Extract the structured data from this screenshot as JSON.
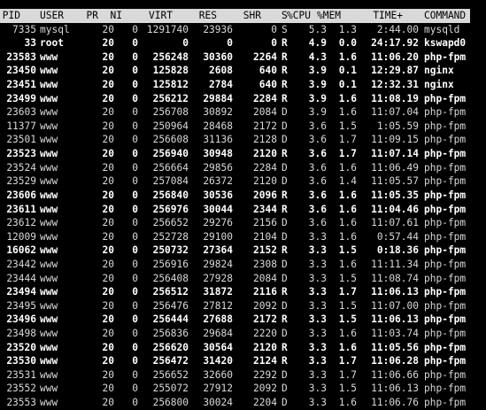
{
  "columns": {
    "pid": "PID",
    "user": "USER",
    "pr": "PR",
    "ni": "NI",
    "virt": "VIRT",
    "res": "RES",
    "shr": "SHR",
    "s": "S",
    "cpu": "%CPU",
    "mem": "%MEM",
    "time": "TIME+",
    "command": "COMMAND"
  },
  "processes": [
    {
      "pid": "7335",
      "user": "mysql",
      "pr": "20",
      "ni": "0",
      "virt": "1291740",
      "res": "23936",
      "shr": "0",
      "s": "S",
      "cpu": "5.3",
      "mem": "1.3",
      "time": "2:44.00",
      "command": "mysqld",
      "bold": false
    },
    {
      "pid": "33",
      "user": "root",
      "pr": "20",
      "ni": "0",
      "virt": "0",
      "res": "0",
      "shr": "0",
      "s": "R",
      "cpu": "4.9",
      "mem": "0.0",
      "time": "24:17.92",
      "command": "kswapd0",
      "bold": true
    },
    {
      "pid": "23583",
      "user": "www",
      "pr": "20",
      "ni": "0",
      "virt": "256248",
      "res": "30360",
      "shr": "2264",
      "s": "R",
      "cpu": "4.3",
      "mem": "1.6",
      "time": "11:06.20",
      "command": "php-fpm",
      "bold": true
    },
    {
      "pid": "23450",
      "user": "www",
      "pr": "20",
      "ni": "0",
      "virt": "125828",
      "res": "2608",
      "shr": "640",
      "s": "R",
      "cpu": "3.9",
      "mem": "0.1",
      "time": "12:29.87",
      "command": "nginx",
      "bold": true
    },
    {
      "pid": "23451",
      "user": "www",
      "pr": "20",
      "ni": "0",
      "virt": "125812",
      "res": "2784",
      "shr": "640",
      "s": "R",
      "cpu": "3.9",
      "mem": "0.1",
      "time": "12:32.31",
      "command": "nginx",
      "bold": true
    },
    {
      "pid": "23499",
      "user": "www",
      "pr": "20",
      "ni": "0",
      "virt": "256212",
      "res": "29884",
      "shr": "2284",
      "s": "R",
      "cpu": "3.9",
      "mem": "1.6",
      "time": "11:08.19",
      "command": "php-fpm",
      "bold": true
    },
    {
      "pid": "23603",
      "user": "www",
      "pr": "20",
      "ni": "0",
      "virt": "256708",
      "res": "30892",
      "shr": "2084",
      "s": "D",
      "cpu": "3.9",
      "mem": "1.6",
      "time": "11:07.04",
      "command": "php-fpm",
      "bold": false
    },
    {
      "pid": "11377",
      "user": "www",
      "pr": "20",
      "ni": "0",
      "virt": "250964",
      "res": "28468",
      "shr": "2172",
      "s": "D",
      "cpu": "3.6",
      "mem": "1.5",
      "time": "1:05.59",
      "command": "php-fpm",
      "bold": false
    },
    {
      "pid": "23501",
      "user": "www",
      "pr": "20",
      "ni": "0",
      "virt": "256608",
      "res": "31136",
      "shr": "2128",
      "s": "D",
      "cpu": "3.6",
      "mem": "1.7",
      "time": "11:09.15",
      "command": "php-fpm",
      "bold": false
    },
    {
      "pid": "23523",
      "user": "www",
      "pr": "20",
      "ni": "0",
      "virt": "256940",
      "res": "30948",
      "shr": "2120",
      "s": "R",
      "cpu": "3.6",
      "mem": "1.7",
      "time": "11:07.14",
      "command": "php-fpm",
      "bold": true
    },
    {
      "pid": "23524",
      "user": "www",
      "pr": "20",
      "ni": "0",
      "virt": "256664",
      "res": "29856",
      "shr": "2284",
      "s": "D",
      "cpu": "3.6",
      "mem": "1.6",
      "time": "11:06.49",
      "command": "php-fpm",
      "bold": false
    },
    {
      "pid": "23529",
      "user": "www",
      "pr": "20",
      "ni": "0",
      "virt": "257084",
      "res": "26372",
      "shr": "2120",
      "s": "D",
      "cpu": "3.6",
      "mem": "1.4",
      "time": "11:05.57",
      "command": "php-fpm",
      "bold": false
    },
    {
      "pid": "23606",
      "user": "www",
      "pr": "20",
      "ni": "0",
      "virt": "256840",
      "res": "30536",
      "shr": "2096",
      "s": "R",
      "cpu": "3.6",
      "mem": "1.6",
      "time": "11:05.35",
      "command": "php-fpm",
      "bold": true
    },
    {
      "pid": "23611",
      "user": "www",
      "pr": "20",
      "ni": "0",
      "virt": "256976",
      "res": "30044",
      "shr": "2344",
      "s": "R",
      "cpu": "3.6",
      "mem": "1.6",
      "time": "11:04.46",
      "command": "php-fpm",
      "bold": true
    },
    {
      "pid": "23612",
      "user": "www",
      "pr": "20",
      "ni": "0",
      "virt": "256652",
      "res": "29276",
      "shr": "2156",
      "s": "D",
      "cpu": "3.6",
      "mem": "1.6",
      "time": "11:07.61",
      "command": "php-fpm",
      "bold": false
    },
    {
      "pid": "12009",
      "user": "www",
      "pr": "20",
      "ni": "0",
      "virt": "252728",
      "res": "29100",
      "shr": "2104",
      "s": "D",
      "cpu": "3.3",
      "mem": "1.6",
      "time": "0:57.44",
      "command": "php-fpm",
      "bold": false
    },
    {
      "pid": "16062",
      "user": "www",
      "pr": "20",
      "ni": "0",
      "virt": "250732",
      "res": "27364",
      "shr": "2152",
      "s": "R",
      "cpu": "3.3",
      "mem": "1.5",
      "time": "0:18.36",
      "command": "php-fpm",
      "bold": true
    },
    {
      "pid": "23442",
      "user": "www",
      "pr": "20",
      "ni": "0",
      "virt": "256916",
      "res": "29824",
      "shr": "2308",
      "s": "D",
      "cpu": "3.3",
      "mem": "1.6",
      "time": "11:11.34",
      "command": "php-fpm",
      "bold": false
    },
    {
      "pid": "23444",
      "user": "www",
      "pr": "20",
      "ni": "0",
      "virt": "256408",
      "res": "27928",
      "shr": "2084",
      "s": "D",
      "cpu": "3.3",
      "mem": "1.5",
      "time": "11:08.74",
      "command": "php-fpm",
      "bold": false
    },
    {
      "pid": "23494",
      "user": "www",
      "pr": "20",
      "ni": "0",
      "virt": "256512",
      "res": "31872",
      "shr": "2116",
      "s": "R",
      "cpu": "3.3",
      "mem": "1.7",
      "time": "11:06.13",
      "command": "php-fpm",
      "bold": true
    },
    {
      "pid": "23495",
      "user": "www",
      "pr": "20",
      "ni": "0",
      "virt": "256476",
      "res": "27812",
      "shr": "2092",
      "s": "D",
      "cpu": "3.3",
      "mem": "1.5",
      "time": "11:07.00",
      "command": "php-fpm",
      "bold": false
    },
    {
      "pid": "23496",
      "user": "www",
      "pr": "20",
      "ni": "0",
      "virt": "256444",
      "res": "27688",
      "shr": "2172",
      "s": "R",
      "cpu": "3.3",
      "mem": "1.5",
      "time": "11:06.13",
      "command": "php-fpm",
      "bold": true
    },
    {
      "pid": "23498",
      "user": "www",
      "pr": "20",
      "ni": "0",
      "virt": "256836",
      "res": "29684",
      "shr": "2220",
      "s": "D",
      "cpu": "3.3",
      "mem": "1.6",
      "time": "11:03.74",
      "command": "php-fpm",
      "bold": false
    },
    {
      "pid": "23520",
      "user": "www",
      "pr": "20",
      "ni": "0",
      "virt": "256620",
      "res": "30564",
      "shr": "2120",
      "s": "R",
      "cpu": "3.3",
      "mem": "1.6",
      "time": "11:05.56",
      "command": "php-fpm",
      "bold": true
    },
    {
      "pid": "23530",
      "user": "www",
      "pr": "20",
      "ni": "0",
      "virt": "256472",
      "res": "31420",
      "shr": "2124",
      "s": "R",
      "cpu": "3.3",
      "mem": "1.7",
      "time": "11:06.28",
      "command": "php-fpm",
      "bold": true
    },
    {
      "pid": "23531",
      "user": "www",
      "pr": "20",
      "ni": "0",
      "virt": "256652",
      "res": "32660",
      "shr": "2292",
      "s": "D",
      "cpu": "3.3",
      "mem": "1.7",
      "time": "11:06.66",
      "command": "php-fpm",
      "bold": false
    },
    {
      "pid": "23552",
      "user": "www",
      "pr": "20",
      "ni": "0",
      "virt": "255072",
      "res": "27912",
      "shr": "2092",
      "s": "D",
      "cpu": "3.3",
      "mem": "1.5",
      "time": "11:06.13",
      "command": "php-fpm",
      "bold": false
    },
    {
      "pid": "23553",
      "user": "www",
      "pr": "20",
      "ni": "0",
      "virt": "256800",
      "res": "30024",
      "shr": "2204",
      "s": "D",
      "cpu": "3.3",
      "mem": "1.6",
      "time": "11:06.76",
      "command": "php-fpm",
      "bold": false
    }
  ]
}
